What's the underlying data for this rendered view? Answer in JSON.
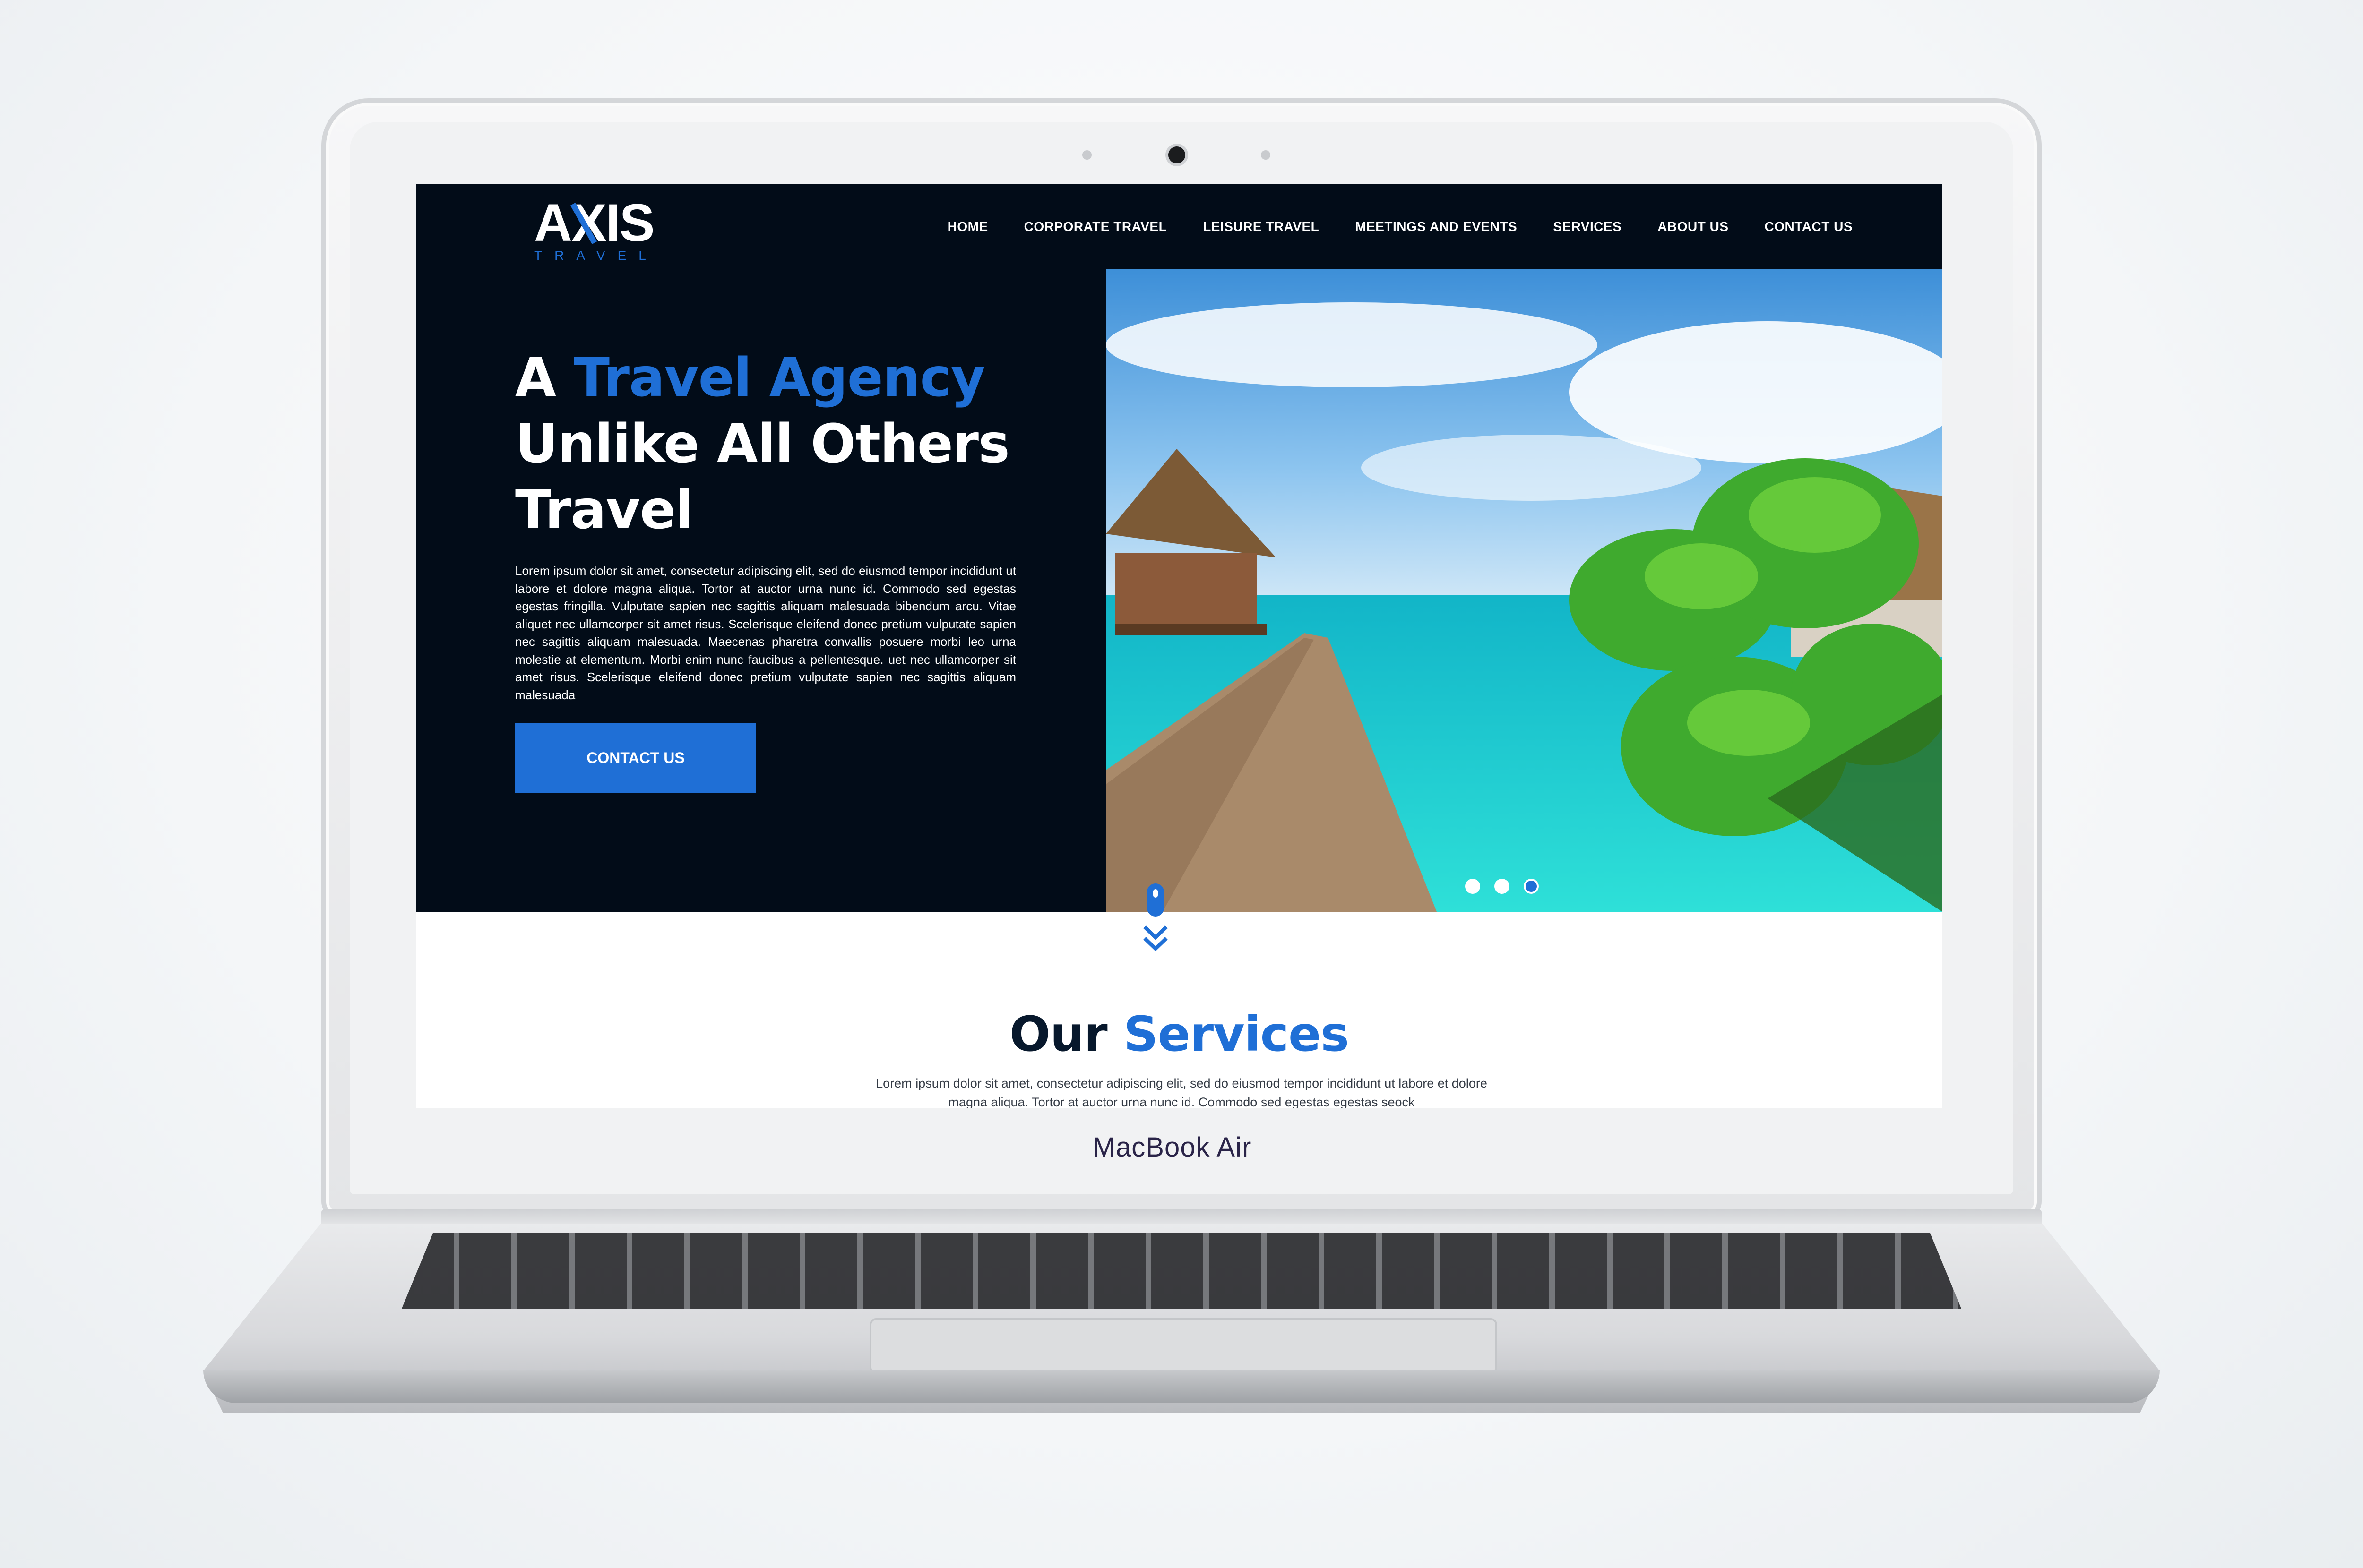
{
  "device": {
    "label": "MacBook Air"
  },
  "site": {
    "logo": {
      "main": "AXIS",
      "sub": "TRAVEL"
    },
    "nav": [
      {
        "label": "HOME"
      },
      {
        "label": "CORPORATE TRAVEL"
      },
      {
        "label": "LEISURE TRAVEL"
      },
      {
        "label": "MEETINGS AND EVENTS"
      },
      {
        "label": "SERVICES"
      },
      {
        "label": "ABOUT US"
      },
      {
        "label": "CONTACT US"
      }
    ],
    "hero": {
      "title_part1": "A ",
      "title_accent": "Travel Agency",
      "title_line2": "Unlike All Others",
      "title_line3": "Travel",
      "body": "Lorem ipsum dolor sit amet, consectetur adipiscing elit, sed do eiusmod tempor incididunt ut labore et dolore magna aliqua. Tortor at auctor urna nunc id. Commodo sed egestas egestas fringilla. Vulputate sapien nec sagittis aliquam malesuada bibendum arcu. Vitae aliquet nec ullamcorper sit amet risus. Scelerisque eleifend donec pretium vulputate sapien nec sagittis aliquam malesuada. Maecenas pharetra convallis posuere morbi leo urna molestie at elementum. Morbi enim nunc faucibus a pellentesque. uet nec ullamcorper sit amet risus. Scelerisque eleifend donec pretium vulputate sapien nec sagittis aliquam malesuada",
      "cta_label": "CONTACT US",
      "slides_total": 3,
      "active_slide": 3
    },
    "services": {
      "title_part1": "Our ",
      "title_accent": "Services",
      "text": "Lorem ipsum dolor sit amet, consectetur adipiscing elit, sed do eiusmod tempor incididunt ut labore et dolore magna aliqua. Tortor at auctor urna nunc id. Commodo sed egestas egestas seock"
    }
  },
  "colors": {
    "nav_bg": "#020c18",
    "accent": "#1f6fd6",
    "text_light": "#ffffff",
    "heading_dark": "#07182c"
  }
}
